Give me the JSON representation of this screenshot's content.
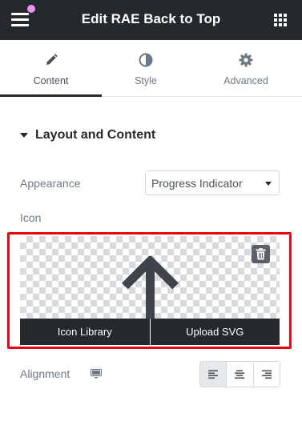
{
  "header": {
    "title": "Edit RAE Back to Top",
    "menu_icon": "hamburger-icon",
    "apps_icon": "grid-icon",
    "notification_color": "#e994f0",
    "background_color": "#26292c"
  },
  "tabs": [
    {
      "label": "Content",
      "icon": "pencil-icon",
      "active": true
    },
    {
      "label": "Style",
      "icon": "contrast-icon",
      "active": false
    },
    {
      "label": "Advanced",
      "icon": "gear-icon",
      "active": false
    }
  ],
  "section": {
    "title": "Layout and Content",
    "expanded": true
  },
  "appearance": {
    "label": "Appearance",
    "value": "Progress Indicator"
  },
  "icon_field": {
    "label": "Icon",
    "preview_icon": "arrow-up-icon",
    "delete_icon": "trash-icon",
    "library_label": "Icon Library",
    "upload_label": "Upload SVG",
    "highlight_color": "#e50914"
  },
  "alignment": {
    "label": "Alignment",
    "device_icon": "desktop-icon",
    "options": [
      {
        "icon": "align-left-icon",
        "active": true
      },
      {
        "icon": "align-center-icon",
        "active": false
      },
      {
        "icon": "align-right-icon",
        "active": false
      }
    ]
  }
}
